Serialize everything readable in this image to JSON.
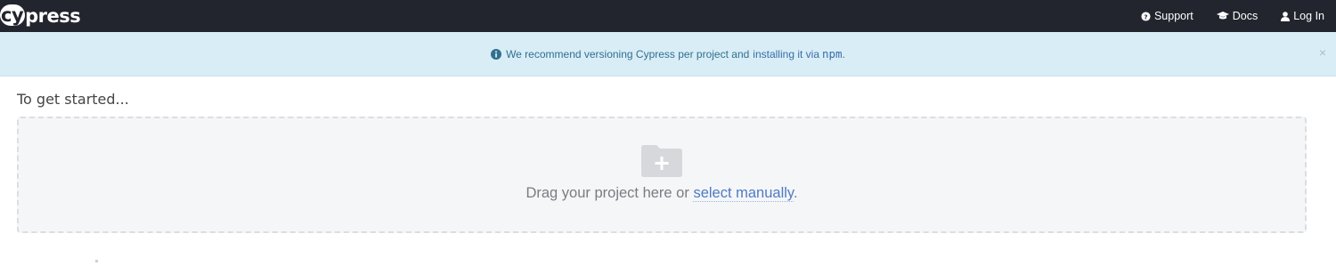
{
  "app": {
    "logo_text_cy": "cy",
    "logo_text_rest": "press"
  },
  "nav": {
    "support_label": "Support",
    "docs_label": "Docs",
    "login_label": "Log In"
  },
  "banner": {
    "message": "We recommend versioning Cypress per project and",
    "link_text": "installing it via",
    "code_text": "npm",
    "period": ".",
    "close_symbol": "×"
  },
  "main": {
    "heading": "To get started...",
    "drop_text": "Drag your project here or",
    "select_link": "select manually",
    "period": "."
  },
  "colors": {
    "topbar": "#23252e",
    "banner_bg": "#d9edf7",
    "link": "#4d7cc2"
  },
  "icons": [
    "info-circle-icon",
    "question-circle-icon",
    "graduation-cap-icon",
    "user-icon",
    "close-icon",
    "folder-plus-icon"
  ]
}
